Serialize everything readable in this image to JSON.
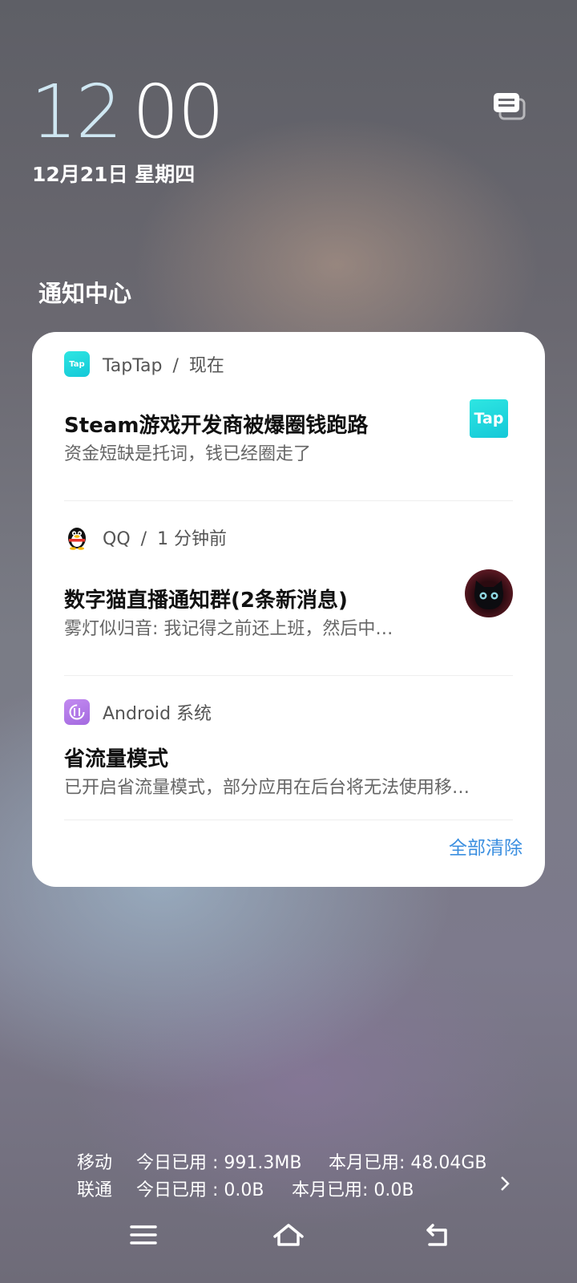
{
  "lockscreen": {
    "time_hour": "12",
    "time_minute": "00",
    "date": "12月21日 星期四"
  },
  "notification_center": {
    "title": "通知中心",
    "clear_all_label": "全部清除",
    "notifications": [
      {
        "app": "TapTap",
        "time": "现在",
        "title": "Steam游戏开发商被爆圈钱跑路",
        "body": "资金短缺是托词，钱已经圈走了",
        "icon": "taptap-icon",
        "thumbnail": "taptap-logo",
        "thumbnail_text": "Tap"
      },
      {
        "app": "QQ",
        "time": "1 分钟前",
        "title": "数字猫直播通知群(2条新消息)",
        "body": "雾灯似归音: 我记得之前还上班，然后中…",
        "icon": "qq-penguin-icon",
        "thumbnail": "black-cat-avatar"
      },
      {
        "app": "Android 系统",
        "time": "",
        "title": "省流量模式",
        "body": "已开启省流量模式，部分应用在后台将无法使用移…",
        "icon": "data-saver-icon"
      }
    ]
  },
  "data_usage": {
    "rows": [
      {
        "carrier": "移动",
        "today": "今日已用 : 991.3MB",
        "month": "本月已用: 48.04GB"
      },
      {
        "carrier": "联通",
        "today": "今日已用 : 0.0B",
        "month": "本月已用: 0.0B"
      }
    ]
  },
  "navigation": [
    "menu-icon",
    "home-icon",
    "back-icon"
  ],
  "colors": {
    "accent": "#3b8fe0",
    "card": "#ffffff",
    "taptap": "#1fd3dc"
  },
  "icons": {
    "top_right": "notification-cards-icon",
    "usage_more": "chevron-right-icon"
  }
}
